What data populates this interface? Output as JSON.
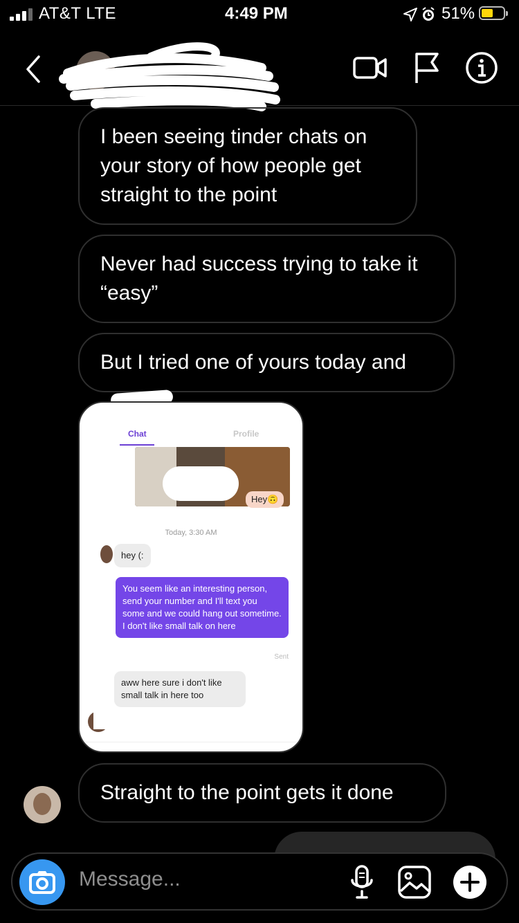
{
  "status_bar": {
    "carrier": "AT&T  LTE",
    "time": "4:49 PM",
    "battery_percent": "51%",
    "battery_level": 0.51
  },
  "header": {
    "contact_name": "",
    "icons": [
      "back-icon",
      "video-call-icon",
      "flag-icon",
      "info-icon"
    ]
  },
  "messages": [
    {
      "text": "I been seeing tinder chats on your story of how people get straight to the point"
    },
    {
      "text": "Never had success trying to take it “easy”"
    },
    {
      "text": "But I tried one of yours today and"
    },
    {
      "text": "Straight to the point gets it done"
    }
  ],
  "shared_screenshot": {
    "tabs": [
      "Chat",
      "Profile"
    ],
    "outgoing_hey": "Hey🙃",
    "timestamp": "Today, 3:30 AM",
    "incoming_1": "hey (:",
    "outgoing_main": "You seem like an interesting person, send your number and I'll text you some and we could hang out sometime. I don't like small talk on here",
    "sent_label": "Sent",
    "incoming_2": "aww here sure i don't like small talk in here too"
  },
  "composer": {
    "placeholder": "Message..."
  },
  "colors": {
    "background": "#000000",
    "bubble_border": "#2f2f2f",
    "camera_button": "#3797f0",
    "tinder_purple": "#7446e8",
    "battery_yellow": "#ffd60a"
  }
}
